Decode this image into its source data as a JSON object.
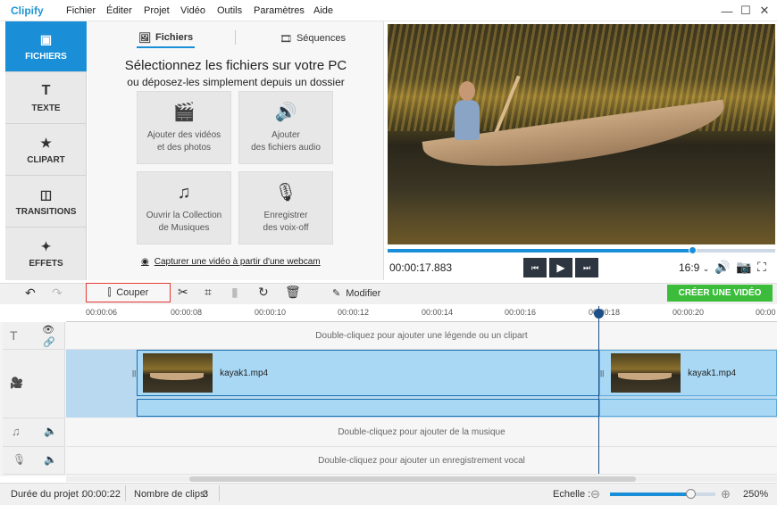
{
  "app": {
    "logo": "Clipify"
  },
  "menu": [
    "Fichier",
    "Éditer",
    "Projet",
    "Vidéo",
    "Outils",
    "Paramètres",
    "Aide"
  ],
  "window_icons": [
    "minimize-icon",
    "maximize-icon",
    "close-icon"
  ],
  "leftnav": [
    {
      "label": "FICHIERS",
      "icon": "image-icon",
      "active": true
    },
    {
      "label": "TEXTE",
      "icon": "text-icon"
    },
    {
      "label": "CLIPART",
      "icon": "star-icon"
    },
    {
      "label": "TRANSITIONS",
      "icon": "transitions-icon"
    },
    {
      "label": "EFFETS",
      "icon": "magic-wand-icon"
    }
  ],
  "panel": {
    "tabs": [
      "Fichiers",
      "Séquences"
    ],
    "title": "Sélectionnez les fichiers sur votre PC",
    "subtitle": "ou déposez-les simplement depuis un dossier",
    "tiles": [
      {
        "l1": "Ajouter des vidéos",
        "l2": "et des photos",
        "icon": "film-reel-icon"
      },
      {
        "l1": "Ajouter",
        "l2": "des fichiers audio",
        "icon": "audio-file-icon"
      },
      {
        "l1": "Ouvrir la Collection",
        "l2": "de Musiques",
        "icon": "music-notes-icon"
      },
      {
        "l1": "Enregistrer",
        "l2": "des voix-off",
        "icon": "microphone-icon"
      }
    ],
    "webcam": "Capturer une vidéo à partir d'une webcam"
  },
  "player": {
    "timecode": "00:00:17.883",
    "ratio": "16:9",
    "progress": 0.785
  },
  "toolbar": {
    "cut": "Couper",
    "modify": "Modifier",
    "create": "CRÉER UNE VIDÉO"
  },
  "ruler": [
    "00:00:06",
    "00:00:08",
    "00:00:10",
    "00:00:12",
    "00:00:14",
    "00:00:16",
    "00:00:18",
    "00:00:20",
    "00:00"
  ],
  "tracks": {
    "caption": "Double-cliquez pour ajouter une légende ou un clipart",
    "clip1": "kayak1.mp4",
    "clip2": "kayak1.mp4",
    "music": "Double-cliquez pour ajouter de la musique",
    "voice": "Double-cliquez pour ajouter un enregistrement vocal"
  },
  "status": {
    "duration_label": "Durée du projet :",
    "duration": "00:00:22",
    "clips_label": "Nombre de clips:",
    "clips": "3",
    "scale_label": "Echelle :",
    "zoom": "250%",
    "zoom_level": 0.76
  },
  "colors": {
    "accent": "#1a8fd8",
    "create": "#3bbd3b",
    "cut_border": "#e53935"
  }
}
